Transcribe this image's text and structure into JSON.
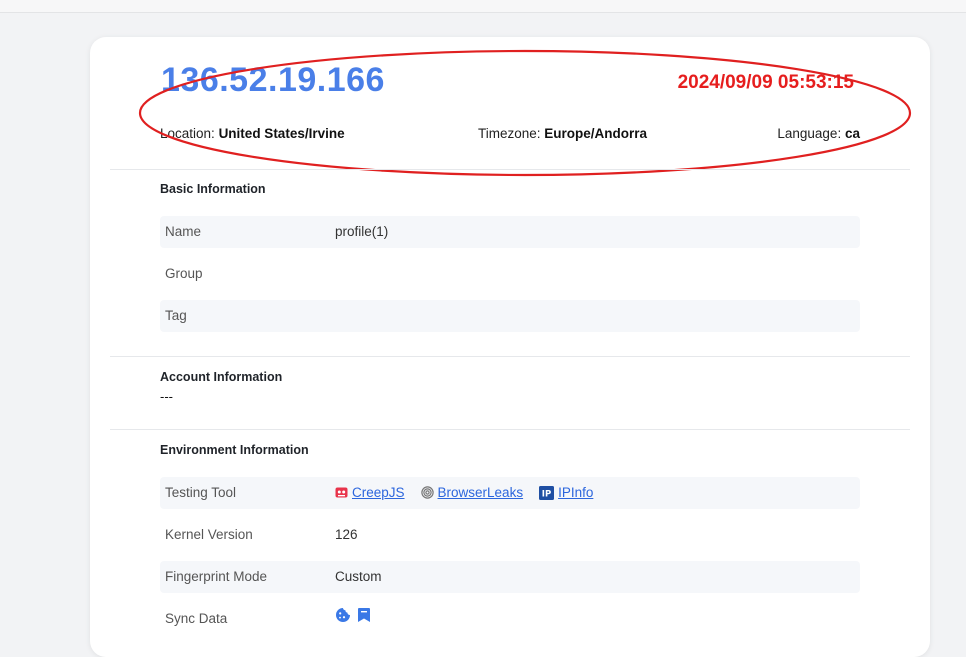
{
  "header": {
    "ip": "136.52.19.166",
    "datetime": "2024/09/09 05:53:15",
    "location_label": "Location:",
    "location_value": "United States/Irvine",
    "timezone_label": "Timezone:",
    "timezone_value": "Europe/Andorra",
    "language_label": "Language:",
    "language_value": "ca"
  },
  "basic": {
    "title": "Basic Information",
    "rows": [
      {
        "label": "Name",
        "value": "profile(1)"
      },
      {
        "label": "Group",
        "value": ""
      },
      {
        "label": "Tag",
        "value": ""
      }
    ]
  },
  "account": {
    "title": "Account Information",
    "value": "---"
  },
  "environment": {
    "title": "Environment Information",
    "testing_tool_label": "Testing Tool",
    "tools": [
      {
        "name": "CreepJS",
        "icon": "creepjs-icon"
      },
      {
        "name": "BrowserLeaks",
        "icon": "fingerprint-icon"
      },
      {
        "name": "IPInfo",
        "icon": "ip-icon"
      }
    ],
    "kernel_label": "Kernel Version",
    "kernel_value": "126",
    "fingerprint_label": "Fingerprint Mode",
    "fingerprint_value": "Custom",
    "sync_label": "Sync Data",
    "sync_icons": [
      "cookie-icon",
      "bookmark-icon"
    ]
  },
  "colors": {
    "ip": "#4a7fe8",
    "datetime": "#e61e1e",
    "annotation": "#e02020",
    "link": "#2c66dd"
  }
}
